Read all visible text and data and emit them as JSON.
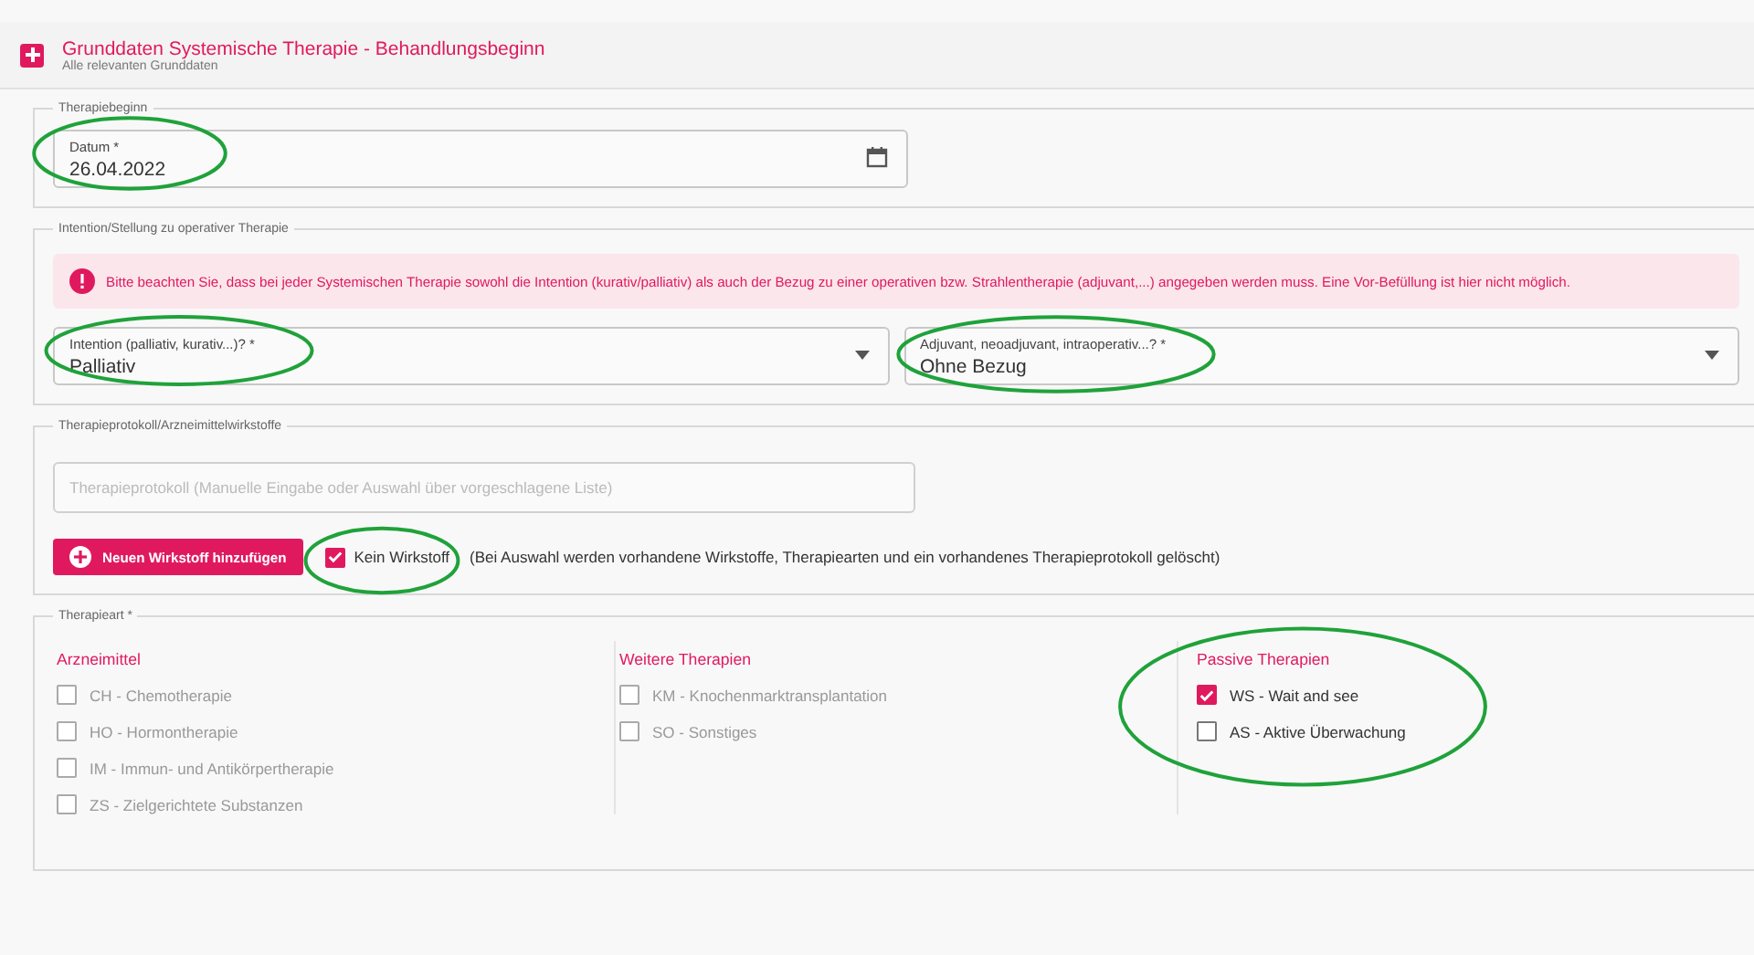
{
  "header": {
    "title": "Grunddaten Systemische Therapie - Behandlungsbeginn",
    "subtitle": "Alle relevanten Grunddaten"
  },
  "therapiebeginn": {
    "legend": "Therapiebeginn",
    "date_field": {
      "label": "Datum *",
      "value": "26.04.2022",
      "highlighted": true
    }
  },
  "intention": {
    "legend": "Intention/Stellung zu operativer Therapie",
    "alert": "Bitte beachten Sie, dass bei jeder Systemischen Therapie sowohl die Intention (kurativ/palliativ) als auch der Bezug zu einer operativen bzw. Strahlentherapie (adjuvant,...) angegeben werden muss. Eine Vor-Befüllung ist hier nicht möglich.",
    "selects": [
      {
        "label": "Intention (palliativ, kurativ...)? *",
        "value": "Palliativ",
        "highlighted": true
      },
      {
        "label": "Adjuvant, neoadjuvant, intraoperativ...? *",
        "value": "Ohne Bezug",
        "highlighted": true
      }
    ]
  },
  "protokoll": {
    "legend": "Therapieprotokoll/Arzneimittelwirkstoffe",
    "placeholder": "Therapieprotokoll (Manuelle Eingabe oder Auswahl über vorgeschlagene Liste)",
    "add_button": "Neuen Wirkstoff hinzufügen",
    "no_agent": {
      "label": "Kein Wirkstoff",
      "note": "(Bei Auswahl werden vorhandene Wirkstoffe, Therapiearten und ein vorhandenes Therapieprotokoll gelöscht)",
      "checked": true,
      "highlighted": true
    }
  },
  "therapieart": {
    "legend": "Therapieart *",
    "columns": [
      {
        "title": "Arzneimittel",
        "highlighted": false,
        "options": [
          {
            "label": "CH - Chemotherapie",
            "checked": false,
            "disabled": true
          },
          {
            "label": "HO - Hormontherapie",
            "checked": false,
            "disabled": true
          },
          {
            "label": "IM - Immun- und Antikörpertherapie",
            "checked": false,
            "disabled": true
          },
          {
            "label": "ZS - Zielgerichtete Substanzen",
            "checked": false,
            "disabled": true
          }
        ]
      },
      {
        "title": "Weitere Therapien",
        "highlighted": false,
        "options": [
          {
            "label": "KM - Knochenmarktransplantation",
            "checked": false,
            "disabled": true
          },
          {
            "label": "SO - Sonstiges",
            "checked": false,
            "disabled": true
          }
        ]
      },
      {
        "title": "Passive Therapien",
        "highlighted": true,
        "options": [
          {
            "label": "WS - Wait and see",
            "checked": true,
            "disabled": false
          },
          {
            "label": "AS - Aktive Überwachung",
            "checked": false,
            "disabled": false
          }
        ]
      }
    ]
  }
}
